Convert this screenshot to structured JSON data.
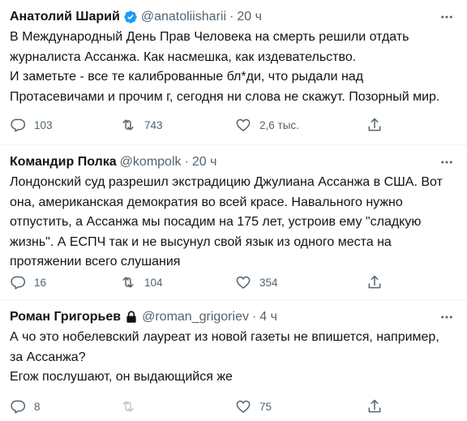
{
  "tweets": [
    {
      "name": "Анатолий Шарий",
      "verified_icon": "verified-badge-icon",
      "handle": "@anatoliisharii",
      "time": "20 ч",
      "lines": [
        "В Международный День Прав Человека на смерть решили отдать",
        "журналиста Ассанжа. Как насмешка, как издевательство.",
        "И заметьте - все те калиброванные бл*ди, что рыдали над",
        "Протасевичами и прочим г, сегодня ни слова не скажут. Позорный мир."
      ],
      "replies": "103",
      "retweets": "743",
      "likes": "2,6 тыс."
    },
    {
      "name": "Командир Полка",
      "handle": "@kompolk",
      "time": "20 ч",
      "lines": [
        "Лондонский суд разрешил экстрадицию Джулиана Ассанжа в США. Вот",
        "она, американская демократия во всей красе. Навального нужно",
        "отпустить, а Ассанжа мы посадим на 175 лет, устроив ему \"сладкую",
        "жизнь\". А ЕСПЧ так и не высунул свой язык из одного места на",
        "протяжении всего слушания"
      ],
      "replies": "16",
      "retweets": "104",
      "likes": "354"
    },
    {
      "name": "Роман Григорьев",
      "lock_icon": "protected-lock-icon",
      "handle": "@roman_grigoriev",
      "time": "4 ч",
      "lines": [
        "А чо это нобелевский лауреат из новой газеты не впишется, например,",
        "за Ассанжа?",
        "Егож послушают, он выдающийся же"
      ],
      "replies": "8",
      "retweets": "",
      "likes": "75"
    }
  ],
  "dot": "·",
  "colors": {
    "verified": "#1d9bf0",
    "secondary": "#536471",
    "text": "#0f1419",
    "divider": "#eff3f4"
  }
}
